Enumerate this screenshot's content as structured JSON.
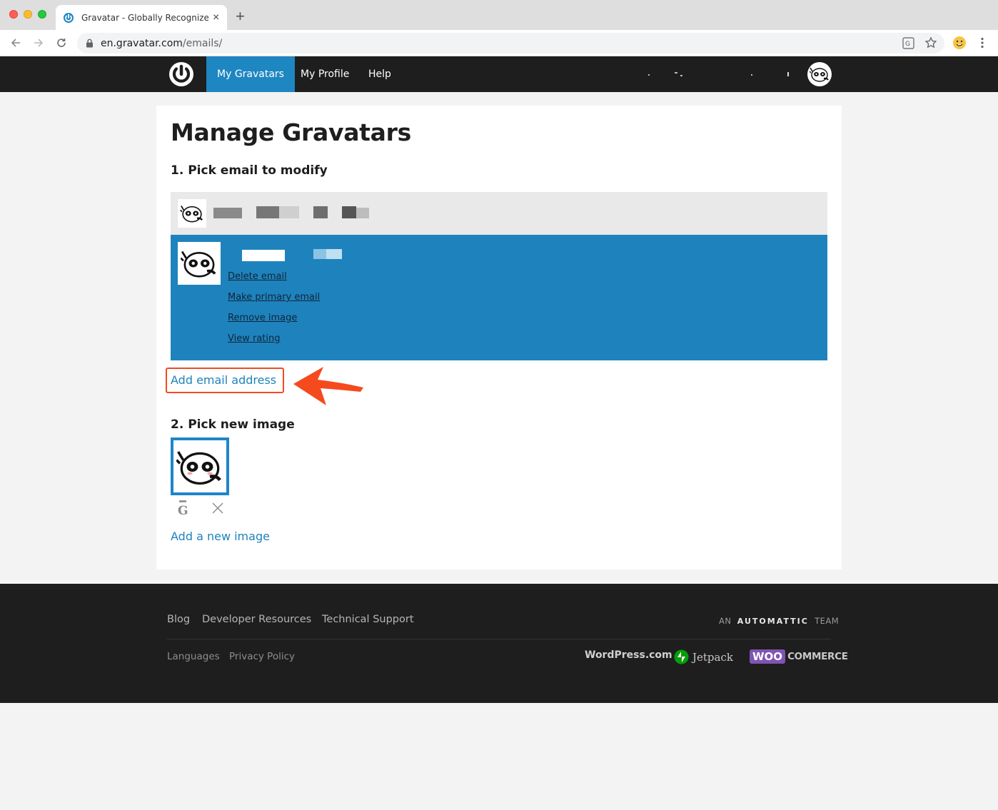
{
  "browser": {
    "tab_title": "Gravatar - Globally Recognized",
    "tab_close": "×",
    "new_tab": "+",
    "url_host": "en.gravatar.com",
    "url_path": "/emails/"
  },
  "header": {
    "nav": [
      {
        "label": "My Gravatars",
        "active": true
      },
      {
        "label": "My Profile",
        "active": false
      },
      {
        "label": "Help",
        "active": false
      }
    ]
  },
  "main": {
    "title": "Manage Gravatars",
    "step1": "1. Pick email to modify",
    "email_actions": [
      "Delete email",
      "Make primary email",
      "Remove image",
      "View rating"
    ],
    "add_email": "Add email address",
    "step2": "2. Pick new image",
    "add_image": "Add a new image"
  },
  "footer": {
    "primary_links": [
      "Blog",
      "Developer Resources",
      "Technical Support"
    ],
    "secondary_links": [
      "Languages",
      "Privacy Policy"
    ],
    "team_prefix": "AN",
    "team_name": "AUTOMATTIC",
    "team_suffix": "TEAM",
    "brands": [
      "WordPress.com",
      "Jetpack",
      "WOO",
      "COMMERCE"
    ]
  },
  "colors": {
    "accent": "#1e86c1",
    "active_row": "#1e83bd",
    "callout": "#f04b23",
    "masthead": "#1e1e1e"
  }
}
